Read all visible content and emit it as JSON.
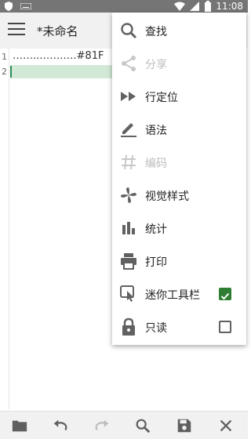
{
  "status_bar": {
    "time": "11:08"
  },
  "app": {
    "title": "*未命名"
  },
  "editor": {
    "line_numbers": [
      "1",
      "2"
    ],
    "line1_text": "……..…….….#81F"
  },
  "menu": {
    "items": [
      {
        "label": "查找",
        "icon": "search-icon",
        "enabled": true
      },
      {
        "label": "分享",
        "icon": "share-icon",
        "enabled": false
      },
      {
        "label": "行定位",
        "icon": "fast-forward-icon",
        "enabled": true
      },
      {
        "label": "语法",
        "icon": "pen-underline-icon",
        "enabled": true
      },
      {
        "label": "编码",
        "icon": "hash-icon",
        "enabled": false
      },
      {
        "label": "视觉样式",
        "icon": "pinwheel-icon",
        "enabled": true
      },
      {
        "label": "统计",
        "icon": "bar-chart-icon",
        "enabled": true
      },
      {
        "label": "打印",
        "icon": "printer-icon",
        "enabled": true
      },
      {
        "label": "迷你工具栏",
        "icon": "touch-app-icon",
        "enabled": true,
        "checked": true
      },
      {
        "label": "只读",
        "icon": "lock-icon",
        "enabled": true,
        "checked": false
      }
    ]
  },
  "bottom_toolbar": {
    "buttons": [
      "folder-icon",
      "undo-icon",
      "redo-icon",
      "search-icon",
      "save-icon",
      "close-icon"
    ]
  },
  "colors": {
    "status_bar": "#757575",
    "toolbar": "#f1f1f1",
    "checkbox_checked": "#2e7d32",
    "current_line": "#d3e9d7"
  }
}
